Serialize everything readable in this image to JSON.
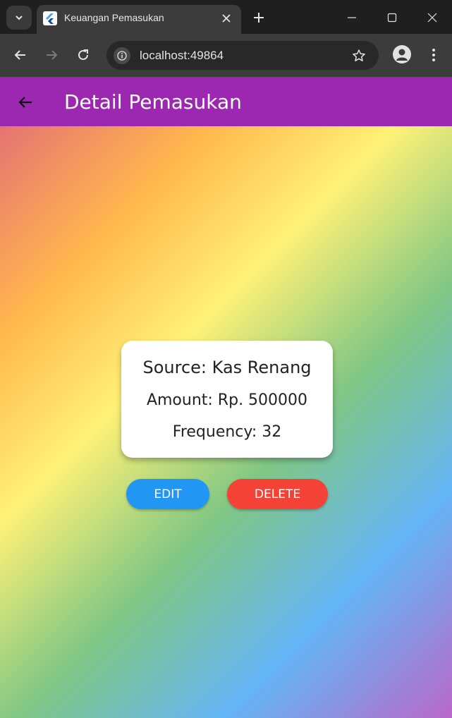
{
  "browser": {
    "tab_title": "Keuangan Pemasukan",
    "url": "localhost:49864",
    "icons": {
      "tab_list": "chevron-down-icon",
      "favicon": "flutter-icon",
      "close": "close-icon",
      "new_tab": "plus-icon",
      "minimize": "minimize-icon",
      "maximize": "maximize-icon",
      "close_window": "close-icon",
      "back": "arrow-left-icon",
      "forward": "arrow-right-icon",
      "reload": "reload-icon",
      "site_info": "info-icon",
      "bookmark": "star-icon",
      "profile": "person-icon",
      "menu": "kebab-menu-icon"
    }
  },
  "appbar": {
    "title": "Detail Pemasukan",
    "color": "#9c27b0"
  },
  "detail": {
    "source": "Source: Kas Renang",
    "amount": "Amount: Rp. 500000",
    "frequency": "Frequency: 32"
  },
  "actions": {
    "edit_label": "EDIT",
    "edit_color": "#2196f3",
    "delete_label": "DELETE",
    "delete_color": "#f44336"
  }
}
